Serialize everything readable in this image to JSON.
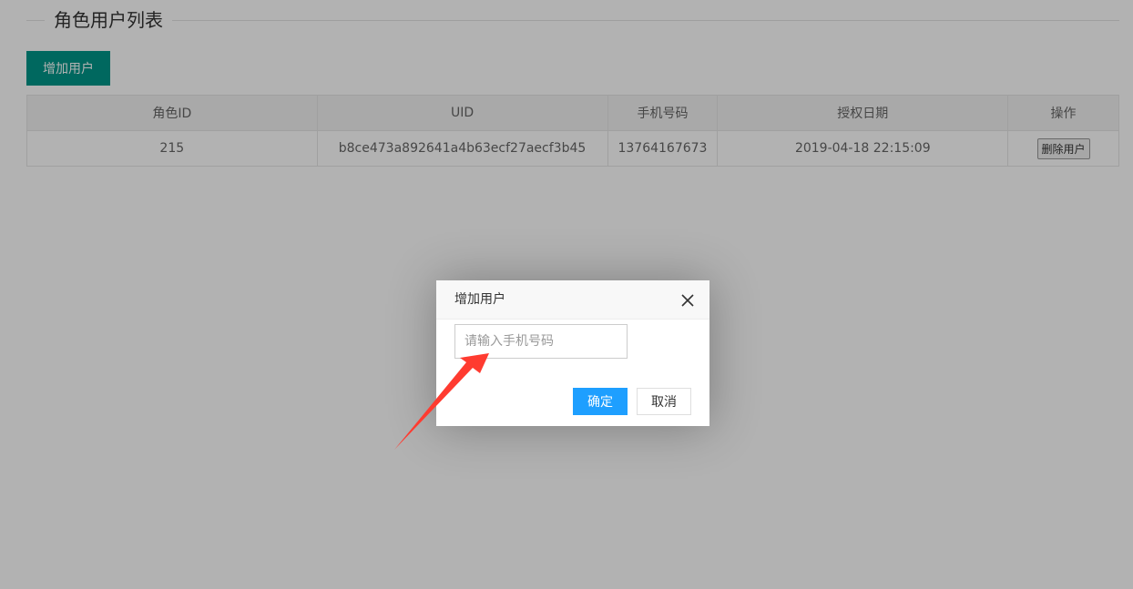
{
  "section": {
    "title": "角色用户列表"
  },
  "toolbar": {
    "add_label": "增加用户"
  },
  "table": {
    "headers": [
      "角色ID",
      "UID",
      "手机号码",
      "授权日期",
      "操作"
    ],
    "rows": [
      {
        "role_id": "215",
        "uid": "b8ce473a892641a4b63ecf27aecf3b45",
        "phone": "13764167673",
        "date": "2019-04-18 22:15:09",
        "action_label": "删除用户"
      }
    ]
  },
  "dialog": {
    "title": "增加用户",
    "input_placeholder": "请输入手机号码",
    "input_value": "",
    "ok_label": "确定",
    "cancel_label": "取消",
    "close_icon": "close-icon"
  },
  "annotation": {
    "arrow_color": "#ff3b30"
  },
  "colors": {
    "primary_green": "#009688",
    "primary_blue": "#1e9fff"
  }
}
